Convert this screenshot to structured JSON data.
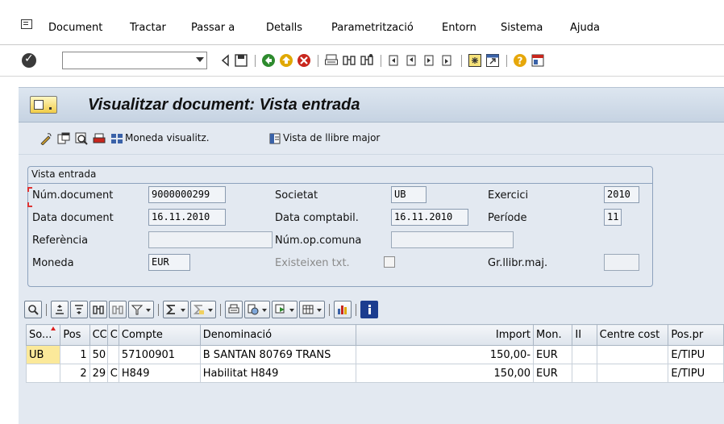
{
  "menu": {
    "items": [
      {
        "label": "Document"
      },
      {
        "label": "Tractar"
      },
      {
        "label": "Passar a"
      },
      {
        "label": "Detalls"
      },
      {
        "label": "Parametrització"
      },
      {
        "label": "Entorn"
      },
      {
        "label": "Sistema"
      },
      {
        "label": "Ajuda"
      }
    ]
  },
  "toolbar": {
    "command_value": "",
    "icons": [
      "enter-check-icon",
      "back-icon",
      "save-icon",
      "back-arrow-icon",
      "exit-icon",
      "cancel-icon",
      "print-icon",
      "find-icon",
      "find-next-icon",
      "first-page-icon",
      "prev-page-icon",
      "next-page-icon",
      "last-page-icon",
      "create-session-icon",
      "shortcut-icon",
      "help-icon",
      "customize-layout-icon"
    ]
  },
  "title": {
    "text": "Visualitzar document: Vista entrada"
  },
  "app_toolbar": {
    "currency_label": "Moneda visualitz.",
    "ledger_label": "Vista de llibre major"
  },
  "entry_view": {
    "group_title": "Vista entrada",
    "doc_number_label": "Núm.document",
    "doc_number": "9000000299",
    "company_label": "Societat",
    "company": "UB",
    "fiscal_year_label": "Exercici",
    "fiscal_year": "2010",
    "doc_date_label": "Data document",
    "doc_date": "16.11.2010",
    "posting_date_label": "Data comptabil.",
    "posting_date": "16.11.2010",
    "period_label": "Període",
    "period": "11",
    "reference_label": "Referència",
    "reference": "",
    "cross_company_label": "Núm.op.comuna",
    "cross_company": "",
    "currency_label": "Moneda",
    "currency": "EUR",
    "texts_exist_label": "Existeixen txt.",
    "ledger_group_label": "Gr.llibr.maj.",
    "ledger_group": ""
  },
  "grid": {
    "columns": [
      "So...",
      "Pos",
      "CC",
      "C",
      "Compte",
      "Denominació",
      "Import",
      "Mon.",
      "II",
      "Centre cost",
      "Pos.pr"
    ],
    "rows": [
      {
        "so": "UB",
        "pos": "1",
        "cc": "50",
        "c": "",
        "compte": "57100901",
        "denominacio": "B SANTAN 80769 TRANS",
        "import": "150,00-",
        "mon": "EUR",
        "ii": "",
        "centre_cost": "",
        "pos_pr": "E/TIPU"
      },
      {
        "so": "",
        "pos": "2",
        "cc": "29",
        "c": "C",
        "compte": "H849",
        "denominacio": "Habilitat H849",
        "import": "150,00",
        "mon": "EUR",
        "ii": "",
        "centre_cost": "",
        "pos_pr": "E/TIPU"
      }
    ]
  },
  "colors": {
    "background": "#e3e9f1",
    "title_gradient_top": "#dde6f0",
    "highlight_cell": "#fbe99a",
    "required_marker": "#dd3333"
  }
}
